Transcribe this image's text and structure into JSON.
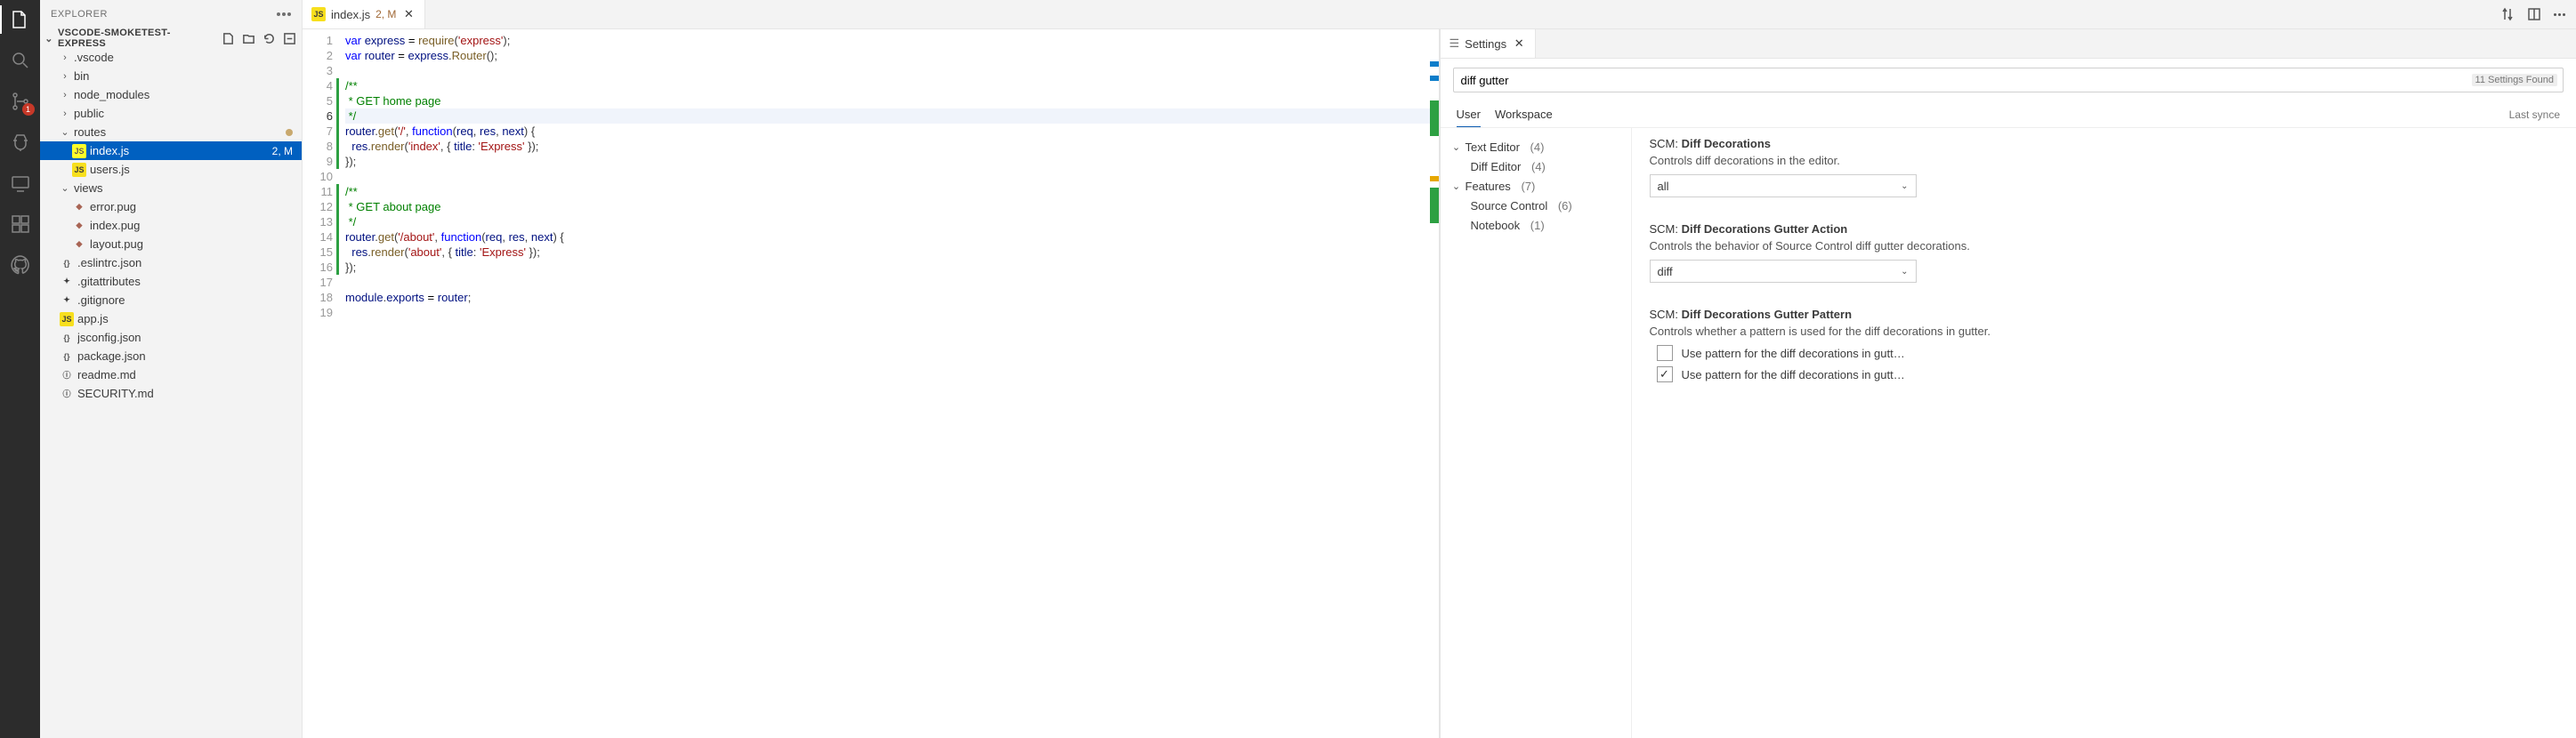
{
  "activity": {
    "scm_badge": "1"
  },
  "explorer": {
    "title": "EXPLORER",
    "section": "VSCODE-SMOKETEST-EXPRESS",
    "tree": {
      "vscode": ".vscode",
      "bin": "bin",
      "node_modules": "node_modules",
      "public": "public",
      "routes": "routes",
      "index_js": "index.js",
      "index_js_badge": "2, M",
      "users_js": "users.js",
      "views": "views",
      "error_pug": "error.pug",
      "index_pug": "index.pug",
      "layout_pug": "layout.pug",
      "eslintrc": ".eslintrc.json",
      "gitattributes": ".gitattributes",
      "gitignore": ".gitignore",
      "app_js": "app.js",
      "jsconfig": "jsconfig.json",
      "package_json": "package.json",
      "readme": "readme.md",
      "security": "SECURITY.md"
    }
  },
  "editor": {
    "tab_name": "index.js",
    "tab_badge": "2, M",
    "lines": [
      "var express = require('express');",
      "var router = express.Router();",
      "",
      "/**",
      " * GET home page",
      " */",
      "router.get('/', function(req, res, next) {",
      "  res.render('index', { title: 'Express' });",
      "});",
      "",
      "/**",
      " * GET about page",
      " */",
      "router.get('/about', function(req, res, next) {",
      "  res.render('about', { title: 'Express' });",
      "});",
      "",
      "module.exports = router;",
      ""
    ]
  },
  "settings": {
    "tab_label": "Settings",
    "search_value": "diff gutter",
    "found_label": "11 Settings Found",
    "scopes": {
      "user": "User",
      "workspace": "Workspace",
      "last_synced": "Last synce"
    },
    "toc": {
      "text_editor": "Text Editor",
      "text_editor_count": "(4)",
      "diff_editor": "Diff Editor",
      "diff_editor_count": "(4)",
      "features": "Features",
      "features_count": "(7)",
      "source_control": "Source Control",
      "source_control_count": "(6)",
      "notebook": "Notebook",
      "notebook_count": "(1)"
    },
    "items": {
      "diff_decorations": {
        "scope": "SCM:",
        "name": "Diff Decorations",
        "desc": "Controls diff decorations in the editor.",
        "value": "all"
      },
      "gutter_action": {
        "scope": "SCM:",
        "name": "Diff Decorations Gutter Action",
        "desc": "Controls the behavior of Source Control diff gutter decorations.",
        "value": "diff"
      },
      "gutter_pattern": {
        "scope": "SCM:",
        "name": "Diff Decorations Gutter Pattern",
        "desc": "Controls whether a pattern is used for the diff decorations in gutter.",
        "opt1": "Use pattern for the diff decorations in gutt…",
        "opt2": "Use pattern for the diff decorations in gutt…"
      }
    }
  }
}
